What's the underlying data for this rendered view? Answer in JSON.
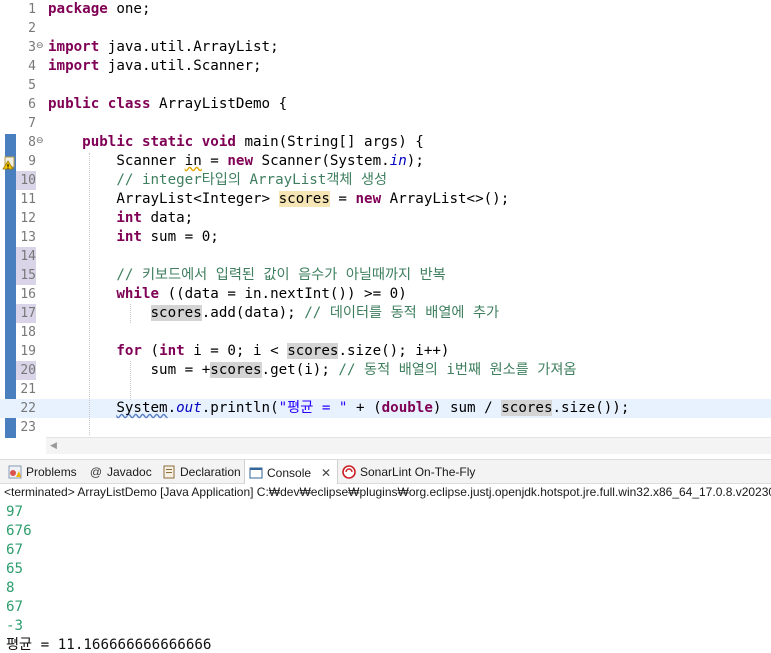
{
  "editor": {
    "lines": [
      {
        "num": "1",
        "html": "<span class='kw'>package</span> one;"
      },
      {
        "num": "2",
        "html": ""
      },
      {
        "num": "3",
        "html": "<span class='kw'>import</span> java.util.ArrayList;"
      },
      {
        "num": "4",
        "html": "<span class='kw'>import</span> java.util.Scanner;"
      },
      {
        "num": "5",
        "html": ""
      },
      {
        "num": "6",
        "html": "<span class='kw'>public</span> <span class='kw'>class</span> ArrayListDemo {"
      },
      {
        "num": "7",
        "html": ""
      },
      {
        "num": "8",
        "html": "    <span class='kw'>public</span> <span class='kw'>static</span> <span class='kw'>void</span> main(String[] args) {"
      },
      {
        "num": "9",
        "html": "        Scanner <span class='warn'>in</span> = <span class='kw'>new</span> Scanner(System.<span class='fld'>in</span>);"
      },
      {
        "num": "10",
        "html": "        <span class='cm'>// integer타입의 ArrayList객체 생성</span>"
      },
      {
        "num": "11",
        "html": "        ArrayList&lt;Integer&gt; <span class='occw'>scores</span> = <span class='kw'>new</span> ArrayList&lt;&gt;();"
      },
      {
        "num": "12",
        "html": "        <span class='kw'>int</span> data;"
      },
      {
        "num": "13",
        "html": "        <span class='kw'>int</span> sum = 0;"
      },
      {
        "num": "14",
        "html": ""
      },
      {
        "num": "15",
        "html": "        <span class='cm'>// 키보드에서 입력된 값이 음수가 아닐때까지 반복</span>"
      },
      {
        "num": "16",
        "html": "        <span class='kw'>while</span> ((data = in.nextInt()) &gt;= 0)"
      },
      {
        "num": "17",
        "html": "            <span class='occ'>scores</span>.add(data); <span class='cm'>// 데이터를 동적 배열에 추가</span>"
      },
      {
        "num": "18",
        "html": ""
      },
      {
        "num": "19",
        "html": "        <span class='kw'>for</span> (<span class='kw'>int</span> i = 0; i &lt; <span class='occ'>scores</span>.size(); i++)"
      },
      {
        "num": "20",
        "html": "            sum = +<span class='occ'>scores</span>.get(i); <span class='cm'>// 동적 배열의 i번째 원소를 가져옴</span>"
      },
      {
        "num": "21",
        "html": ""
      },
      {
        "num": "22",
        "html": "        <span class='err'>System</span>.<span class='fld'>out</span>.println(<span class='st'>\"평균 = \"</span> + (<span class='kw'>double</span>) sum / <span class='occ'>scores</span>.size());"
      },
      {
        "num": "23",
        "html": ""
      }
    ]
  },
  "tabs": {
    "problems": "Problems",
    "javadoc": "Javadoc",
    "declaration": "Declaration",
    "console": "Console",
    "close": "✕",
    "sonarlint": "SonarLint On-The-Fly"
  },
  "console": {
    "status": "<terminated> ArrayListDemo [Java Application] C:₩dev₩eclipse₩plugins₩org.eclipse.justj.openjdk.hotspot.jre.full.win32.x86_64_17.0.8.v20230",
    "inputs": [
      "97",
      "676",
      "67",
      "65",
      "8",
      "67",
      "-3"
    ],
    "result": "평균 = 11.166666666666666"
  },
  "colors": {
    "keyword": "#7f0055",
    "comment": "#3f7f5f",
    "string": "#2a00ff",
    "console_input": "#2e9e6e",
    "current_line": "#e8f2fe"
  }
}
